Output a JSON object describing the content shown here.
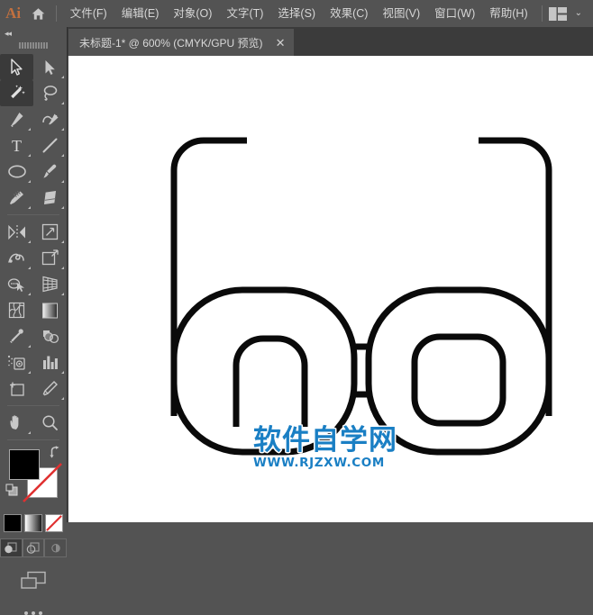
{
  "app": {
    "name": "Ai",
    "logo_color": "#c2703f",
    "bg": "#535353"
  },
  "menubar": {
    "home_icon": "home-icon",
    "items": [
      {
        "label": "文件(F)"
      },
      {
        "label": "编辑(E)"
      },
      {
        "label": "对象(O)"
      },
      {
        "label": "文字(T)"
      },
      {
        "label": "选择(S)"
      },
      {
        "label": "效果(C)"
      },
      {
        "label": "视图(V)"
      },
      {
        "label": "窗口(W)"
      },
      {
        "label": "帮助(H)"
      }
    ],
    "workspace_switcher": {
      "icon": "workspace-layout-icon",
      "chevron": "⌄"
    }
  },
  "tabbar": {
    "tabs": [
      {
        "title": "未标题-1* @ 600% (CMYK/GPU 预览)",
        "close": "✕",
        "active": true
      }
    ]
  },
  "toolbar": {
    "collapse": "◂◂",
    "tools": [
      [
        {
          "name": "selection-tool",
          "selected": true,
          "flyout": false
        },
        {
          "name": "direct-selection-tool",
          "selected": false,
          "flyout": true
        }
      ],
      [
        {
          "name": "magic-wand-tool",
          "selected": true,
          "flyout": false
        },
        {
          "name": "lasso-tool",
          "selected": false,
          "flyout": true
        }
      ],
      [
        {
          "name": "pen-tool",
          "selected": false,
          "flyout": true
        },
        {
          "name": "curvature-tool",
          "selected": false,
          "flyout": true
        }
      ],
      [
        {
          "name": "type-tool",
          "selected": false,
          "flyout": true
        },
        {
          "name": "line-segment-tool",
          "selected": false,
          "flyout": true
        }
      ],
      [
        {
          "name": "ellipse-tool",
          "selected": false,
          "flyout": true
        },
        {
          "name": "paintbrush-tool",
          "selected": false,
          "flyout": true
        }
      ],
      [
        {
          "name": "shaper-tool",
          "selected": false,
          "flyout": true
        },
        {
          "name": "eraser-tool",
          "selected": false,
          "flyout": true
        }
      ],
      [
        {
          "name": "rotate-reflect-tool",
          "selected": false,
          "flyout": true
        },
        {
          "name": "scale-tool",
          "selected": false,
          "flyout": true
        }
      ],
      [
        {
          "name": "width-warp-tool",
          "selected": false,
          "flyout": true
        },
        {
          "name": "free-transform-tool",
          "selected": false,
          "flyout": true
        }
      ],
      [
        {
          "name": "shape-builder-tool",
          "selected": false,
          "flyout": true
        },
        {
          "name": "perspective-grid-tool",
          "selected": false,
          "flyout": true
        }
      ],
      [
        {
          "name": "mesh-tool",
          "selected": false,
          "flyout": false
        },
        {
          "name": "gradient-tool",
          "selected": false,
          "flyout": false
        }
      ],
      [
        {
          "name": "eyedropper-tool",
          "selected": false,
          "flyout": true
        },
        {
          "name": "blend-tool",
          "selected": false,
          "flyout": false
        }
      ],
      [
        {
          "name": "symbol-sprayer-tool",
          "selected": false,
          "flyout": true
        },
        {
          "name": "column-graph-tool",
          "selected": false,
          "flyout": true
        }
      ],
      [
        {
          "name": "artboard-tool",
          "selected": false,
          "flyout": false
        },
        {
          "name": "slice-tool",
          "selected": false,
          "flyout": true
        }
      ],
      [
        {
          "name": "hand-tool",
          "selected": false,
          "flyout": true
        },
        {
          "name": "zoom-tool",
          "selected": false,
          "flyout": false
        }
      ]
    ],
    "swatches": {
      "fill_color": "#000000",
      "stroke_color": "#ffffff",
      "swap_icon": "swap-fill-stroke-icon",
      "default_icon": "default-fill-stroke-icon"
    },
    "color_modes": [
      {
        "name": "color-mode-button",
        "active": true
      },
      {
        "name": "gradient-mode-button",
        "active": false
      },
      {
        "name": "none-mode-button",
        "active": false
      }
    ],
    "draw_modes": [
      {
        "name": "draw-normal-button",
        "active": true
      },
      {
        "name": "draw-behind-button",
        "active": false
      },
      {
        "name": "draw-inside-button",
        "active": false
      }
    ],
    "screen_mode": {
      "name": "change-screen-mode-icon"
    },
    "more_tools": {
      "name": "edit-toolbar-button",
      "label": "•••"
    }
  },
  "canvas": {
    "background": "#ffffff",
    "artwork_name": "eyeglasses-outline-artwork",
    "stroke_color": "#000000"
  },
  "watermark": {
    "chinese": "软件自学网",
    "url": "WWW.RJZXW.COM",
    "color": "#1a7fc4"
  }
}
